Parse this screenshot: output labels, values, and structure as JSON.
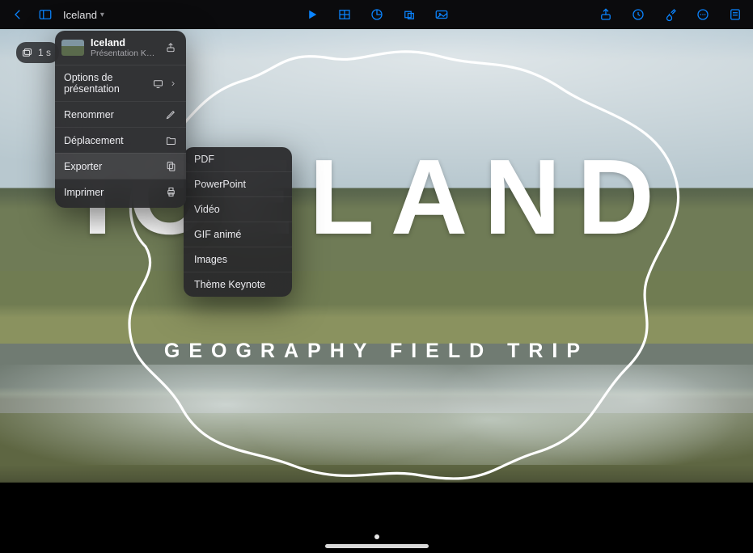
{
  "toolbar": {
    "doc_title": "Iceland"
  },
  "slide_nav": {
    "count_label": "1 s"
  },
  "popover": {
    "header": {
      "title": "Iceland",
      "subtitle": "Présentation Keynote…"
    },
    "items": [
      {
        "label": "Options de présentation",
        "icon": "display",
        "chevron": true
      },
      {
        "label": "Renommer",
        "icon": "pencil"
      },
      {
        "label": "Déplacement",
        "icon": "folder"
      },
      {
        "label": "Exporter",
        "icon": "export",
        "highlight": true
      },
      {
        "label": "Imprimer",
        "icon": "printer"
      }
    ]
  },
  "export_submenu": [
    "PDF",
    "PowerPoint",
    "Vidéo",
    "GIF animé",
    "Images",
    "Thème Keynote"
  ],
  "slide": {
    "title": "ICELAND",
    "subtitle": "GEOGRAPHY FIELD TRIP"
  }
}
